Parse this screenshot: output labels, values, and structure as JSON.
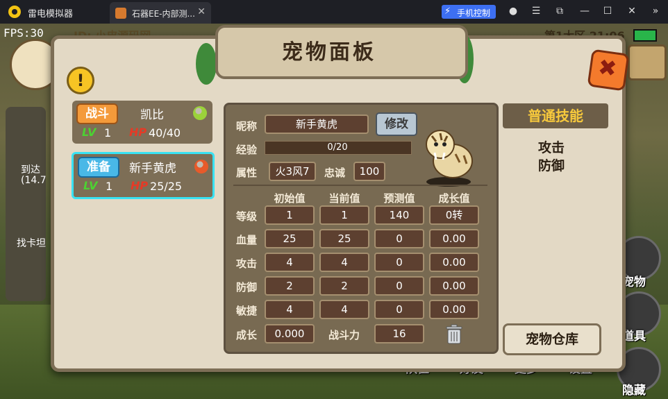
{
  "window": {
    "app_name": "雷电模拟器",
    "tab_title": "石器EE-内部测...",
    "phone_control": "手机控制"
  },
  "hud": {
    "fps": "FPS:30",
    "uid": "ID: 小皮源码网",
    "zone": "第1大区 21:06",
    "left_items": [
      "到达",
      "(14.7",
      "找卡坦"
    ],
    "bottom_buttons": [
      "队伍",
      "好友",
      "更多",
      "设置"
    ],
    "side_buttons": [
      "宠物",
      "道具",
      "隐藏"
    ]
  },
  "panel": {
    "title": "宠物面板",
    "pets": [
      {
        "status": "战斗",
        "name": "凯比",
        "lv_label": "LV",
        "lv": "1",
        "hp_label": "HP",
        "hp": "40/40",
        "gem_color": "#9bd23a"
      },
      {
        "status": "准备",
        "name": "新手黄虎",
        "lv_label": "LV",
        "lv": "1",
        "hp_label": "HP",
        "hp": "25/25",
        "gem_color": "#e85a2a"
      }
    ],
    "nickname_label": "昵称",
    "nickname": "新手黄虎",
    "edit_label": "修改",
    "exp_label": "经验",
    "exp_text": "0/20",
    "exp_fraction": 0,
    "attr_label": "属性",
    "attr_value": "火3风7",
    "loyalty_label": "忠诚",
    "loyalty_value": "100",
    "columns": [
      "初始值",
      "当前值",
      "预测值",
      "成长值"
    ],
    "rows": [
      {
        "label": "等级",
        "values": [
          "1",
          "1",
          "140",
          "0转"
        ]
      },
      {
        "label": "血量",
        "values": [
          "25",
          "25",
          "0",
          "0.00"
        ]
      },
      {
        "label": "攻击",
        "values": [
          "4",
          "4",
          "0",
          "0.00"
        ]
      },
      {
        "label": "防御",
        "values": [
          "2",
          "2",
          "0",
          "0.00"
        ]
      },
      {
        "label": "敏捷",
        "values": [
          "4",
          "4",
          "0",
          "0.00"
        ]
      }
    ],
    "growth_label": "成长",
    "growth_value": "0.000",
    "power_label": "战斗力",
    "power_value": "16",
    "skills_title": "普通技能",
    "skills": [
      "攻击",
      "防御"
    ],
    "store_label": "宠物仓库"
  }
}
